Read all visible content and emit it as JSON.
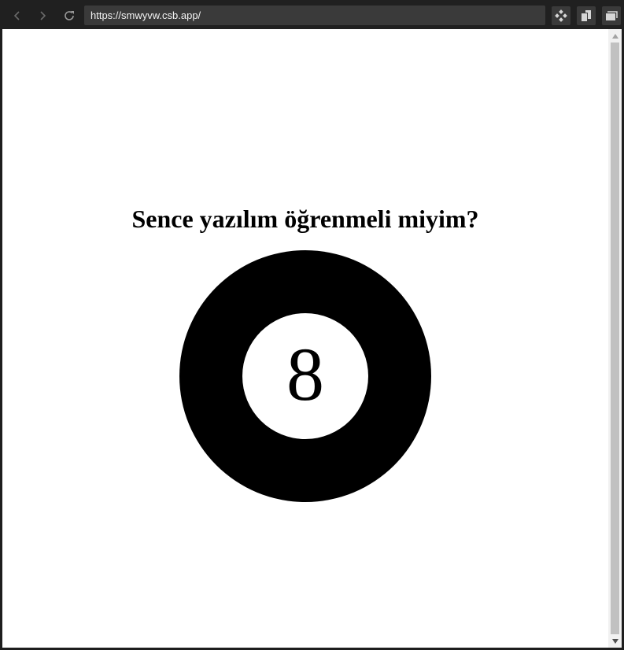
{
  "browser": {
    "url": "https://smwyvw.csb.app/",
    "icons": {
      "back": "chevron-left-icon",
      "forward": "chevron-right-icon",
      "reload": "reload-icon",
      "extension": "diamond-grid-icon",
      "split": "split-view-icon",
      "windows": "windows-icon"
    }
  },
  "page": {
    "title": "Sence yazılım öğrenmeli miyim?",
    "ball_number": "8"
  },
  "colors": {
    "toolbar": "#202020",
    "url_bar": "#3a3a3a",
    "ball": "#000000",
    "ball_window": "#ffffff",
    "scroll_thumb": "#c1c1c1"
  }
}
